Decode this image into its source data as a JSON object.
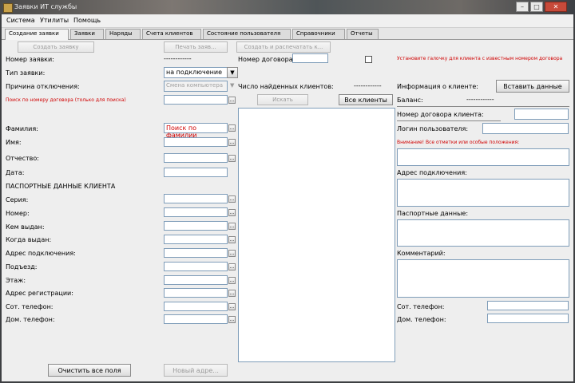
{
  "window": {
    "title": "Заявки ИТ службы",
    "min_glyph": "–",
    "max_glyph": "□",
    "close_glyph": "✕"
  },
  "menu": [
    "Система",
    "Утилиты",
    "Помощь"
  ],
  "tabs": [
    "Создание заявки",
    "Заявки",
    "Наряды",
    "Счета клиентов",
    "Состояние пользователя",
    "Справочники",
    "Отчеты"
  ],
  "toolbar": {
    "create": "Создать заявку",
    "print": "Печать заяв...",
    "create_print": "Создать и распечатать к..."
  },
  "form": {
    "request_number_label": "Номер заявки:",
    "request_number_value": "------------",
    "contract_label": "Номер договора:",
    "contract_value": "",
    "contract_note": "Установите галочку для клиента с известным номером договора",
    "type_label": "Тип заявки:",
    "type_value": "на подключение",
    "reason_label": "Причина отключения:",
    "reason_value": "Смена компьютера",
    "found_clients_label": "Число найденных клиентов:",
    "found_clients_value": "------------",
    "client_info_label": "Информация о клиенте:",
    "insert_data_button": "Вставить данные",
    "search_contract_note": "Поиск по номеру договора (только для поиска)",
    "search_button": "Искать",
    "all_clients_button": "Все клиенты",
    "balance_label": "Баланс:",
    "balance_value": "------------",
    "surname_label": "Фамилия:",
    "surname_search_note": "Поиск по фамилии",
    "name_label": "Имя:",
    "patronymic_label": "Отчество:",
    "date_label": "Дата:",
    "passport_section": "ПАСПОРТНЫЕ ДАННЫЕ КЛИЕНТА",
    "series_label": "Серия:",
    "number_label": "Номер:",
    "issued_by_label": "Кем выдан:",
    "issued_when_label": "Когда выдан:",
    "connection_address_label": "Адрес подключения:",
    "entrance_label": "Подъезд:",
    "floor_label": "Этаж:",
    "registration_address_label": "Адрес регистрации:",
    "mobile_label": "Сот. телефон:",
    "home_phone_label": "Дом. телефон:",
    "clear_all_button": "Очистить все поля",
    "new_address_button": "Новый адре..."
  },
  "client_panel": {
    "contract_number_label": "Номер договора клиента:",
    "login_label": "Логин пользователя:",
    "attention_label": "Внимание! Все отметки или особые положения:",
    "connection_address_label": "Адрес подключения:",
    "passport_label": "Паспортные данные:",
    "comment_label": "Комментарий:",
    "mobile_label": "Сот. телефон:",
    "home_phone_label": "Дом. телефон:"
  },
  "colors": {
    "note_red": "#d00000",
    "field_border": "#7f9db9"
  },
  "icons": {
    "dropdown": "▼",
    "field_button": "..."
  }
}
